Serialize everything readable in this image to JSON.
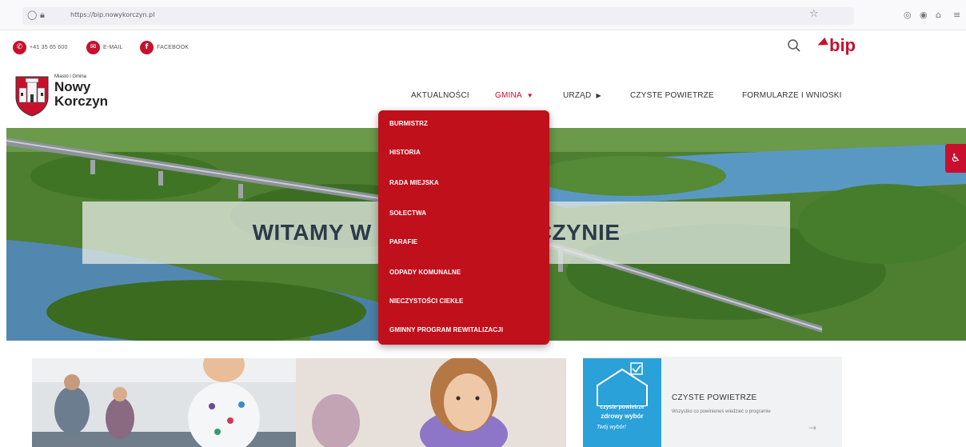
{
  "browser": {
    "url": "https://bip.nowykorczyn.pl"
  },
  "topbar": {
    "phone": "+41 35 65 600",
    "email": "E-MAIL",
    "facebook": "FACEBOOK",
    "bip": "bip"
  },
  "logo": {
    "small": "Miasto i Gmina",
    "line1": "Nowy",
    "line2": "Korczyn"
  },
  "nav": {
    "items": [
      {
        "label": "AKTUALNOŚCI"
      },
      {
        "label": "GMINA",
        "arrow": "▼"
      },
      {
        "label": "URZĄD",
        "arrow": "▶"
      },
      {
        "label": "CZYSTE POWIETRZE"
      },
      {
        "label": "FORMULARZE I WNIOSKI"
      }
    ]
  },
  "dropdown": {
    "items": [
      "BURMISTRZ",
      "HISTORIA",
      "RADA MIEJSKA",
      "SOŁECTWA",
      "PARAFIE",
      "ODPADY KOMUNALNE",
      "NIECZYSTOŚCI CIEKŁE",
      "GMINNY PROGRAM REWITALIZACJI"
    ]
  },
  "hero": {
    "welcome_left": "WITAMY W",
    "welcome_right": "CZYNIE"
  },
  "card": {
    "badge_line1": "czyste powietrze",
    "badge_line2": "zdrowy wybór",
    "badge_line3": "Twój wybór!",
    "title": "CZYSTE POWIETRZE",
    "desc": "Wszystko co powinieneś wiedzieć o programie",
    "arrow": "→"
  },
  "colors": {
    "accent": "#c8102e",
    "dropdown_bg": "#c0101c",
    "badge_blue": "#2aa1d8"
  }
}
